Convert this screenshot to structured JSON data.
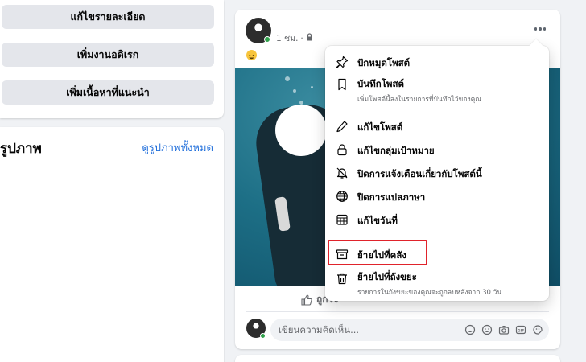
{
  "left_panel": {
    "buttons": [
      "แก้ไขรายละเอียด",
      "เพิ่มงานอดิเรก",
      "เพิ่มเนื้อหาที่แนะนำ"
    ],
    "photos": {
      "title": "รูปภาพ",
      "see_all": "ดูรูปภาพทั้งหมด"
    }
  },
  "post": {
    "time": "1 ชม.",
    "separator": "·",
    "privacy_icon": "lock-icon",
    "emoji": "😀",
    "like_label": "ถูกใจ",
    "comment_placeholder": "เขียนความคิดเห็น..."
  },
  "menu": {
    "items": [
      {
        "label": "ปักหมุดโพสต์",
        "icon": "pin-icon"
      },
      {
        "label": "บันทึกโพสต์",
        "sub": "เพิ่มโพสต์นี้ลงในรายการที่บันทึกไว้ของคุณ",
        "icon": "bookmark-icon"
      },
      {
        "label": "แก้ไขโพสต์",
        "icon": "pencil-icon"
      },
      {
        "label": "แก้ไขกลุ่มเป้าหมาย",
        "icon": "lock-icon"
      },
      {
        "label": "ปิดการแจ้งเตือนเกี่ยวกับโพสต์นี้",
        "icon": "bell-off-icon"
      },
      {
        "label": "ปิดการแปลภาษา",
        "icon": "globe-icon"
      },
      {
        "label": "แก้ไขวันที่",
        "icon": "calendar-icon"
      },
      {
        "label": "ย้ายไปที่คลัง",
        "icon": "archive-icon"
      },
      {
        "label": "ย้ายไปที่ถังขยะ",
        "sub": "รายการในถังขยะของคุณจะถูกลบหลังจาก 30 วัน",
        "icon": "trash-icon"
      }
    ],
    "highlight_color": "#e0232b"
  },
  "colors": {
    "link": "#216fdb",
    "online": "#31a24c"
  }
}
